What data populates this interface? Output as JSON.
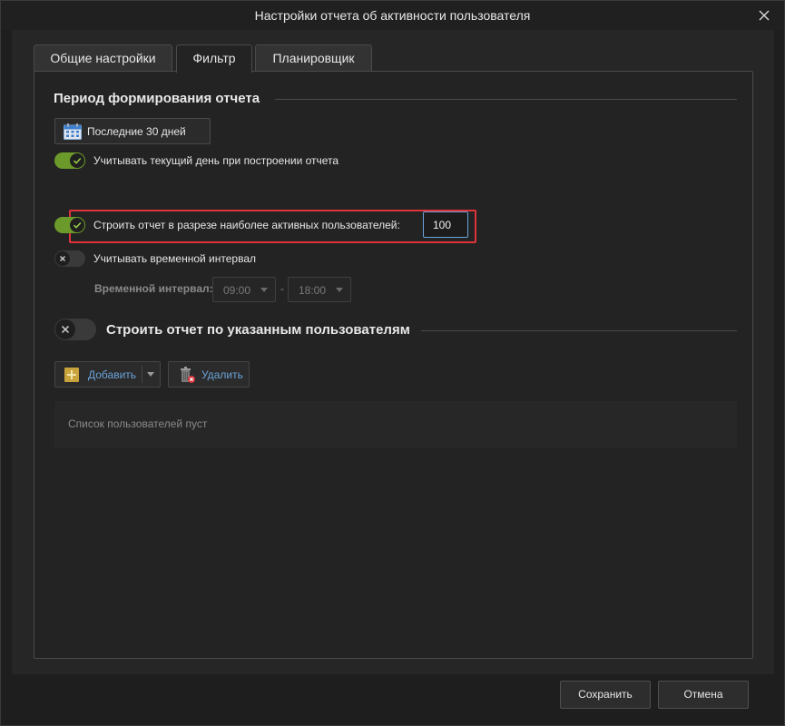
{
  "window": {
    "title": "Настройки отчета об активности пользователя"
  },
  "tabs": [
    {
      "label": "Общие настройки",
      "active": false
    },
    {
      "label": "Фильтр",
      "active": true
    },
    {
      "label": "Планировщик",
      "active": false
    }
  ],
  "period": {
    "section_title": "Период формирования отчета",
    "button_label": "Последние 30 дней",
    "options": [
      {
        "label": "Учитывать текущий день при построении отчета",
        "enabled": true
      },
      {
        "label": "Строить отчет в разрезе наиболее активных пользователей:",
        "enabled": true,
        "value": "100"
      },
      {
        "label": "Учитывать временной интервал",
        "enabled": false
      }
    ],
    "interval": {
      "label": "Временной интервал:",
      "from": "09:00",
      "to": "18:00",
      "separator": "-"
    }
  },
  "users": {
    "section_title": "Строить отчет по указанным пользователям",
    "enabled": false,
    "add_label": "Добавить",
    "delete_label": "Удалить",
    "empty_text": "Список пользователей пуст"
  },
  "footer": {
    "save_label": "Сохранить",
    "cancel_label": "Отмена"
  },
  "colors": {
    "toggle_on": "#6c9a2a",
    "highlight": "#e0333a",
    "input_focus": "#6aa3d8",
    "link_text": "#6aa3d8"
  }
}
